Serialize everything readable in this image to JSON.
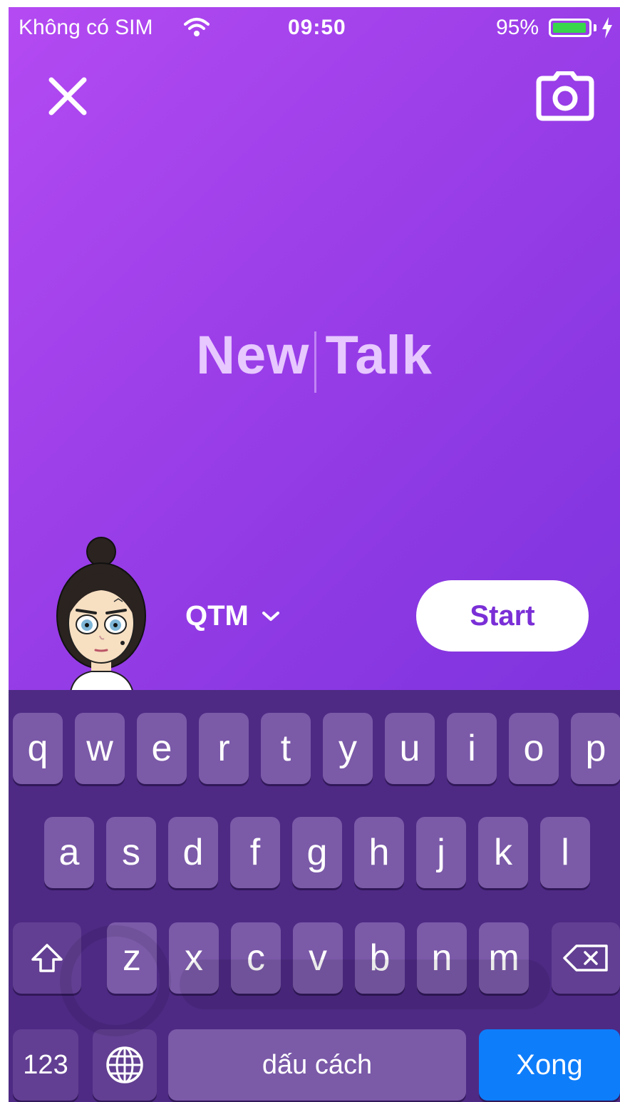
{
  "status_bar": {
    "carrier": "Không có SIM",
    "time": "09:50",
    "battery_percent": "95%",
    "battery_level": 0.95,
    "battery_color": "#37d64b"
  },
  "header": {
    "close_icon": "close-icon",
    "camera_icon": "camera-icon"
  },
  "composer": {
    "title_value": "New Talk"
  },
  "account": {
    "name": "QTM",
    "dropdown_icon": "chevron-down-icon"
  },
  "start_button": {
    "label": "Start"
  },
  "keyboard": {
    "row1": [
      "q",
      "w",
      "e",
      "r",
      "t",
      "y",
      "u",
      "i",
      "o",
      "p"
    ],
    "row2": [
      "a",
      "s",
      "d",
      "f",
      "g",
      "h",
      "j",
      "k",
      "l"
    ],
    "row3": [
      "z",
      "x",
      "c",
      "v",
      "b",
      "n",
      "m"
    ],
    "numbers_label": "123",
    "space_label": "dấu cách",
    "done_label": "Xong",
    "shift_icon": "shift-icon",
    "delete_icon": "delete-icon",
    "globe_icon": "globe-icon"
  },
  "colors": {
    "gradient_start": "#b44af2",
    "gradient_end": "#7430d6",
    "accent": "#7a2fd6",
    "done_key": "#0e7dfa"
  }
}
